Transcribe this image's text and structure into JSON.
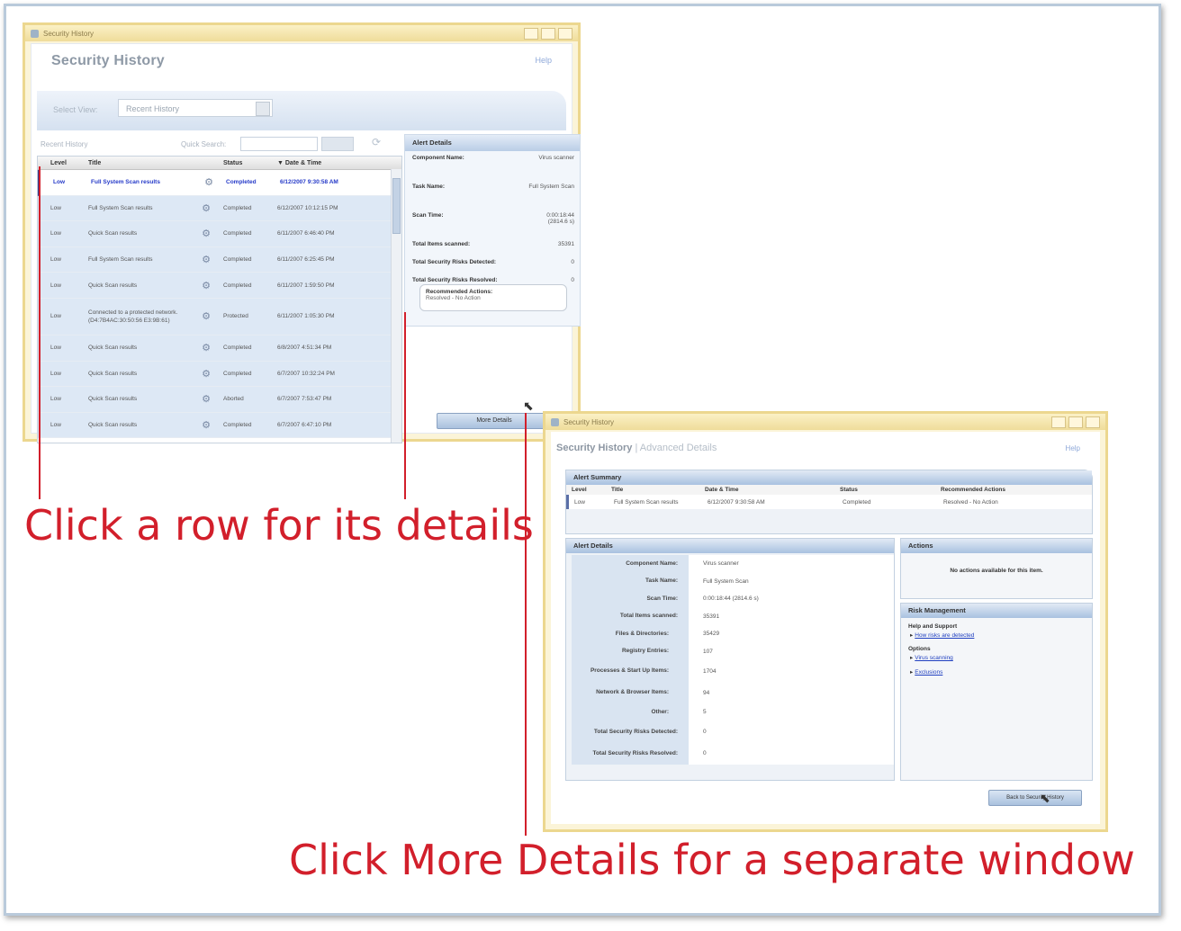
{
  "window1": {
    "titlebar": "Security History",
    "title": "Security History",
    "help": "Help",
    "select_view_label": "Select View:",
    "select_view_value": "Recent History",
    "list_title": "Recent History",
    "quick_search_label": "Quick Search:",
    "columns": [
      "Level",
      "Title",
      "",
      "Status",
      "▼ Date & Time"
    ],
    "rows": [
      {
        "level": "Low",
        "title": "Full System Scan results",
        "status": "Completed",
        "date": "6/12/2007 9:30:58 AM"
      },
      {
        "level": "Low",
        "title": "Full System Scan results",
        "status": "Completed",
        "date": "6/12/2007 10:12:15 PM"
      },
      {
        "level": "Low",
        "title": "Quick Scan results",
        "status": "Completed",
        "date": "6/11/2007 6:46:40 PM"
      },
      {
        "level": "Low",
        "title": "Full System Scan results",
        "status": "Completed",
        "date": "6/11/2007 6:25:45 PM"
      },
      {
        "level": "Low",
        "title": "Quick Scan results",
        "status": "Completed",
        "date": "6/11/2007 1:59:50 PM"
      },
      {
        "level": "Low",
        "title": "Connected to a protected network. (D4:7B4AC:30:50:56 E3:9B:61)",
        "status": "Protected",
        "date": "6/11/2007 1:05:30 PM"
      },
      {
        "level": "Low",
        "title": "Quick Scan results",
        "status": "Completed",
        "date": "6/8/2007 4:51:34 PM"
      },
      {
        "level": "Low",
        "title": "Quick Scan results",
        "status": "Completed",
        "date": "6/7/2007 10:32:24 PM"
      },
      {
        "level": "Low",
        "title": "Quick Scan results",
        "status": "Aborted",
        "date": "6/7/2007 7:53:47 PM"
      },
      {
        "level": "Low",
        "title": "Quick Scan results",
        "status": "Completed",
        "date": "6/7/2007 6:47:10 PM"
      }
    ],
    "alert_details": {
      "header": "Alert Details",
      "items": [
        {
          "k": "Component Name:",
          "v": "Virus scanner"
        },
        {
          "k": "Task Name:",
          "v": "Full System Scan"
        },
        {
          "k": "Scan Time:",
          "v": "0:00:18:44 (2814.6 s)"
        },
        {
          "k": "Total Items scanned:",
          "v": "35391"
        },
        {
          "k": "Total Security Risks Detected:",
          "v": "0"
        },
        {
          "k": "Total Security Risks Resolved:",
          "v": "0"
        }
      ],
      "recommended_title": "Recommended Actions:",
      "recommended_value": "Resolved - No Action"
    },
    "more_details_button": "More Details"
  },
  "window2": {
    "titlebar": "Security History",
    "title": "Security History",
    "subtitle": "Advanced Details",
    "help": "Help",
    "summary": {
      "header": "Alert Summary",
      "columns": [
        "Level",
        "Title",
        "Date & Time",
        "Status",
        "Recommended Actions"
      ],
      "row": [
        "Low",
        "Full System Scan results",
        "6/12/2007 9:30:58 AM",
        "Completed",
        "Resolved - No Action"
      ]
    },
    "details": {
      "header": "Alert Details",
      "items": [
        {
          "k": "Component Name:",
          "v": "Virus scanner",
          "indent": false
        },
        {
          "k": "Task Name:",
          "v": "Full System Scan",
          "indent": false
        },
        {
          "k": "Scan Time:",
          "v": "0:00:18:44 (2814.6 s)",
          "indent": false
        },
        {
          "k": "Total Items scanned:",
          "v": "35391",
          "indent": false
        },
        {
          "k": "Files & Directories:",
          "v": "35429",
          "indent": true
        },
        {
          "k": "Registry Entries:",
          "v": "107",
          "indent": true
        },
        {
          "k": "Processes & Start Up Items:",
          "v": "1704",
          "indent": true
        },
        {
          "k": "Network & Browser Items:",
          "v": "94",
          "indent": true
        },
        {
          "k": "Other:",
          "v": "5",
          "indent": true
        },
        {
          "k": "Total Security Risks Detected:",
          "v": "0",
          "indent": false
        },
        {
          "k": "Total Security Risks Resolved:",
          "v": "0",
          "indent": false
        }
      ]
    },
    "actions": {
      "header": "Actions",
      "message": "No actions available for this item."
    },
    "risk": {
      "header": "Risk Management",
      "help_title": "Help and Support",
      "help_link": "How risks are detected",
      "options_title": "Options",
      "option_links": [
        "Virus scanning",
        "Exclusions"
      ]
    },
    "back_button": "Back to Security History"
  },
  "annotations": {
    "caption1": "Click a row for its details",
    "caption2": "Click More Details for a separate window"
  },
  "colors": {
    "annotation": "#d21f2b",
    "window_border": "#ecd78f",
    "panel_header": "#a8c1e0",
    "link": "#1f3fc0"
  }
}
